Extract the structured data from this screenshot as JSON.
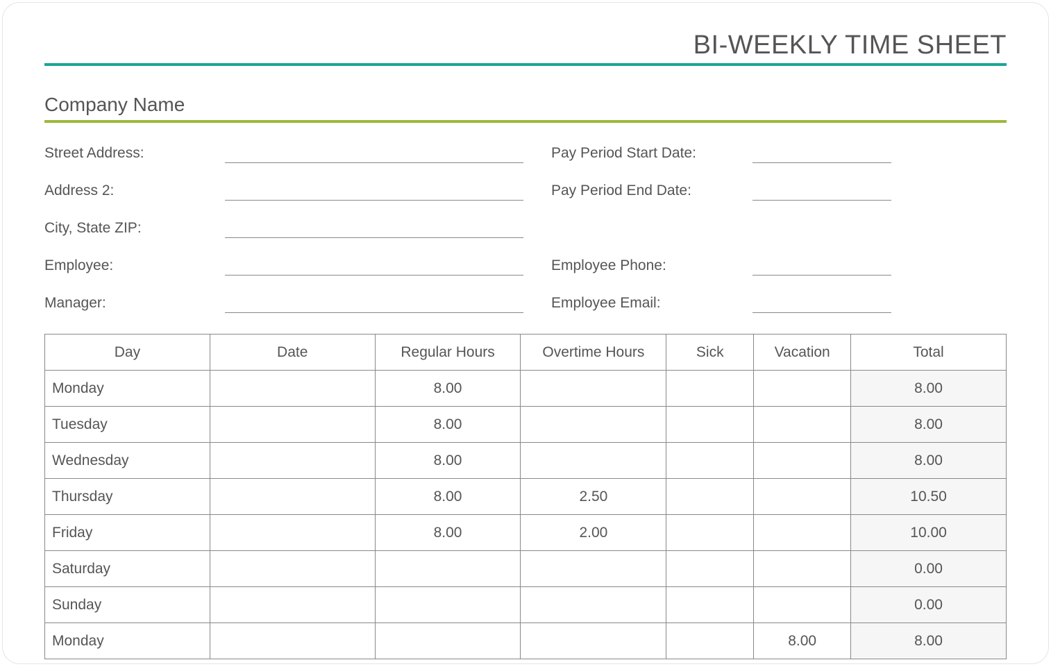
{
  "header": {
    "title": "BI-WEEKLY TIME SHEET",
    "company_name": "Company Name"
  },
  "info": {
    "left": [
      {
        "label": "Street Address:",
        "value": ""
      },
      {
        "label": "Address 2:",
        "value": ""
      },
      {
        "label": "City, State ZIP:",
        "value": ""
      },
      {
        "label": "Employee:",
        "value": ""
      },
      {
        "label": "Manager:",
        "value": ""
      }
    ],
    "right": [
      {
        "label": "Pay Period Start Date:",
        "value": ""
      },
      {
        "label": "Pay Period End Date:",
        "value": ""
      },
      {
        "label": "",
        "value": ""
      },
      {
        "label": "Employee Phone:",
        "value": ""
      },
      {
        "label": "Employee Email:",
        "value": ""
      }
    ]
  },
  "table": {
    "headers": [
      "Day",
      "Date",
      "Regular Hours",
      "Overtime Hours",
      "Sick",
      "Vacation",
      "Total"
    ],
    "rows": [
      {
        "day": "Monday",
        "date": "",
        "regular": "8.00",
        "overtime": "",
        "sick": "",
        "vacation": "",
        "total": "8.00"
      },
      {
        "day": "Tuesday",
        "date": "",
        "regular": "8.00",
        "overtime": "",
        "sick": "",
        "vacation": "",
        "total": "8.00"
      },
      {
        "day": "Wednesday",
        "date": "",
        "regular": "8.00",
        "overtime": "",
        "sick": "",
        "vacation": "",
        "total": "8.00"
      },
      {
        "day": "Thursday",
        "date": "",
        "regular": "8.00",
        "overtime": "2.50",
        "sick": "",
        "vacation": "",
        "total": "10.50"
      },
      {
        "day": "Friday",
        "date": "",
        "regular": "8.00",
        "overtime": "2.00",
        "sick": "",
        "vacation": "",
        "total": "10.00"
      },
      {
        "day": "Saturday",
        "date": "",
        "regular": "",
        "overtime": "",
        "sick": "",
        "vacation": "",
        "total": "0.00"
      },
      {
        "day": "Sunday",
        "date": "",
        "regular": "",
        "overtime": "",
        "sick": "",
        "vacation": "",
        "total": "0.00"
      },
      {
        "day": "Monday",
        "date": "",
        "regular": "",
        "overtime": "",
        "sick": "",
        "vacation": "8.00",
        "total": "8.00"
      }
    ]
  }
}
